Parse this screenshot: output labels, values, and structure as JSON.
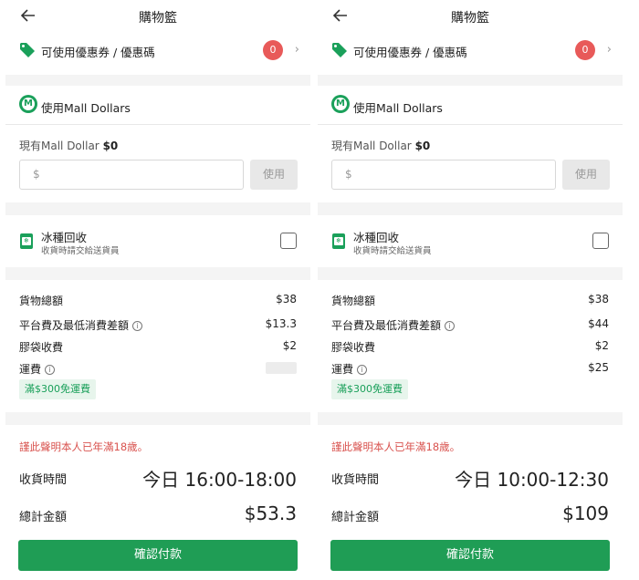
{
  "screens": [
    {
      "header": {
        "title": "購物籃"
      },
      "coupon": {
        "label": "可使用優惠券 / 優惠碼",
        "count": "0"
      },
      "mall_dollars": {
        "label": "使用Mall Dollars",
        "balance_label": "現有Mall Dollar",
        "balance_value": "$0",
        "input_placeholder": "$",
        "use_label": "使用"
      },
      "ice_recycle": {
        "title": "冰種回收",
        "subtitle": "收貨時請交給送貨員"
      },
      "fees": {
        "goods_total_label": "貨物總額",
        "goods_total_value": "$38",
        "platform_fee_label": "平台費及最低消費差額",
        "platform_fee_value": "$13.3",
        "bag_fee_label": "膠袋收費",
        "bag_fee_value": "$2",
        "shipping_label": "運費",
        "shipping_value": "",
        "free_shipping_tag": "滿$300免運費"
      },
      "notice": "謹此聲明本人已年滿18歲。",
      "delivery_time_label": "收貨時間",
      "delivery_time_value": "今日 16:00-18:00",
      "total_label": "總計金額",
      "total_value": "$53.3",
      "confirm_label": "確認付款"
    },
    {
      "header": {
        "title": "購物籃"
      },
      "coupon": {
        "label": "可使用優惠券 / 優惠碼",
        "count": "0"
      },
      "mall_dollars": {
        "label": "使用Mall Dollars",
        "balance_label": "現有Mall Dollar",
        "balance_value": "$0",
        "input_placeholder": "$",
        "use_label": "使用"
      },
      "ice_recycle": {
        "title": "冰種回收",
        "subtitle": "收貨時請交給送貨員"
      },
      "fees": {
        "goods_total_label": "貨物總額",
        "goods_total_value": "$38",
        "platform_fee_label": "平台費及最低消費差額",
        "platform_fee_value": "$44",
        "bag_fee_label": "膠袋收費",
        "bag_fee_value": "$2",
        "shipping_label": "運費",
        "shipping_value": "$25",
        "free_shipping_tag": "滿$300免運費"
      },
      "notice": "謹此聲明本人已年滿18歲。",
      "delivery_time_label": "收貨時間",
      "delivery_time_value": "今日 10:00-12:30",
      "total_label": "總計金額",
      "total_value": "$109",
      "confirm_label": "確認付款"
    }
  ],
  "icons": {
    "back": "back-arrow-icon",
    "coupon": "tag-icon",
    "chevron": "chevron-right-icon",
    "mall": "mall-dollar-icon",
    "ice": "ice-box-icon",
    "info": "info-icon"
  },
  "colors": {
    "brand_green": "#1f9d55",
    "badge_red": "#e85a59",
    "notice_red": "#d9534f",
    "free_ship_bg": "#e7f5ec"
  }
}
